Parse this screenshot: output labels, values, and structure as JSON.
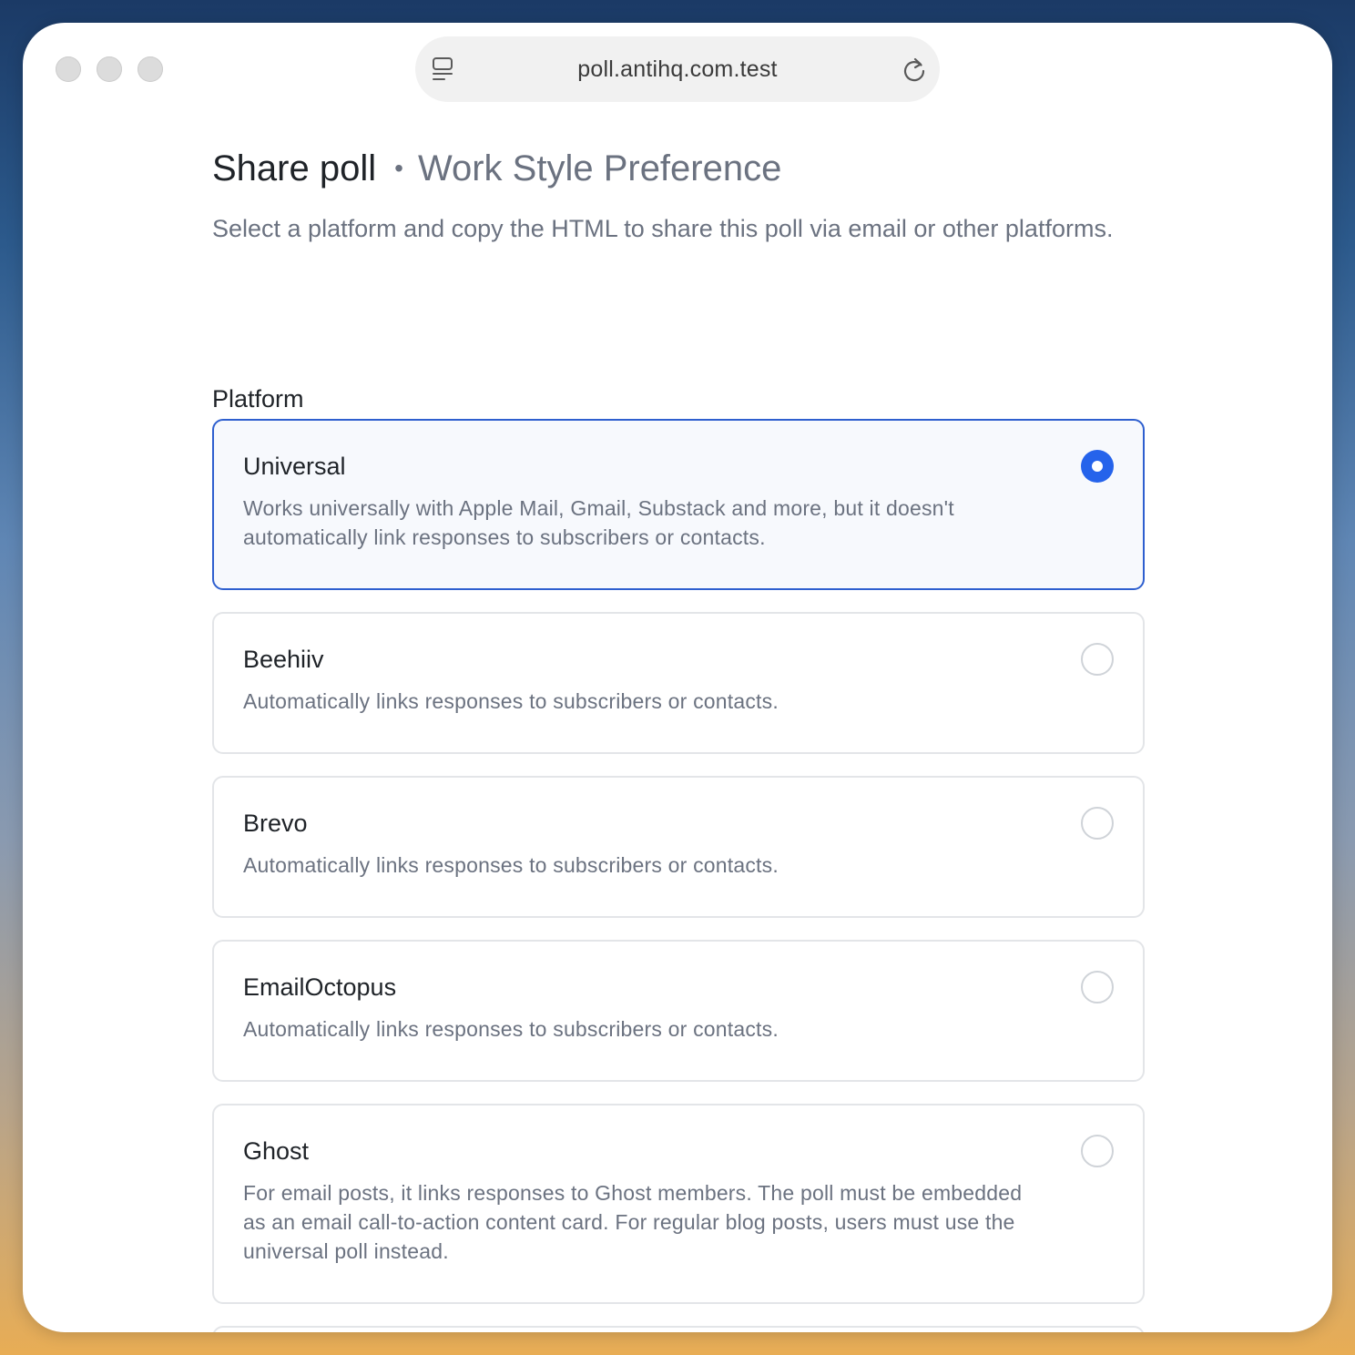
{
  "browser": {
    "url": "poll.antihq.com.test",
    "page_icon": "page-reader-icon",
    "reload_icon": "reload-icon"
  },
  "header": {
    "title": "Share poll",
    "separator": "•",
    "poll_name": "Work Style Preference",
    "description": "Select a platform and copy the HTML to share this poll via email or other platforms."
  },
  "platform": {
    "label": "Platform",
    "selected": "Universal",
    "options": [
      {
        "title": "Universal",
        "description": "Works universally with Apple Mail, Gmail, Substack and more, but it doesn't automatically link responses to subscribers or contacts.",
        "checked": true
      },
      {
        "title": "Beehiiv",
        "description": "Automatically links responses to subscribers or contacts.",
        "checked": false
      },
      {
        "title": "Brevo",
        "description": "Automatically links responses to subscribers or contacts.",
        "checked": false
      },
      {
        "title": "EmailOctopus",
        "description": "Automatically links responses to subscribers or contacts.",
        "checked": false
      },
      {
        "title": "Ghost",
        "description": "For email posts, it links responses to Ghost members. The poll must be embedded as an email call-to-action content card. For regular blog posts, users must use the universal poll instead.",
        "checked": false
      }
    ]
  },
  "colors": {
    "accent": "#2563eb",
    "selected_border": "#2e5fcf",
    "text_primary": "#1f2328",
    "text_secondary": "#6b7280"
  }
}
